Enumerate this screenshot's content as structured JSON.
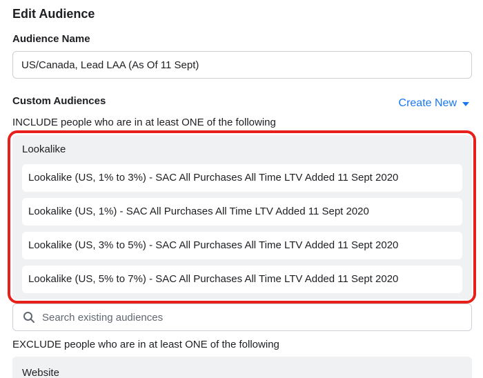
{
  "dialog": {
    "title": "Edit Audience"
  },
  "audience_name": {
    "label": "Audience Name",
    "value": "US/Canada, Lead LAA (As Of 11 Sept)"
  },
  "custom_audiences": {
    "label": "Custom Audiences",
    "create_new_label": "Create New",
    "include": {
      "rule_text": "INCLUDE people who are in at least ONE of the following",
      "group_label": "Lookalike",
      "items": [
        "Lookalike (US, 1% to 3%) - SAC All Purchases All Time LTV Added 11 Sept 2020",
        "Lookalike (US, 1%) - SAC All Purchases All Time LTV Added 11 Sept 2020",
        "Lookalike (US, 3% to 5%) - SAC All Purchases All Time LTV Added 11 Sept 2020",
        "Lookalike (US, 5% to 7%) - SAC All Purchases All Time LTV Added 11 Sept 2020"
      ]
    },
    "search": {
      "placeholder": "Search existing audiences",
      "icon": "search-icon"
    },
    "exclude": {
      "rule_text": "EXCLUDE people who are in at least ONE of the following",
      "group_label": "Website"
    }
  },
  "colors": {
    "accent": "#1877f2",
    "highlight": "#e8201b",
    "group_bg": "#f0f1f3"
  }
}
